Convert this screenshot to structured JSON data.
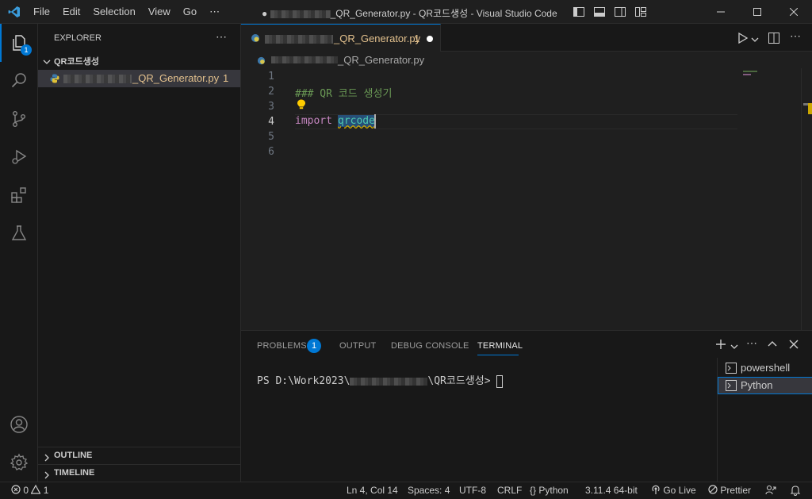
{
  "titlebar": {
    "menus": [
      "File",
      "Edit",
      "Selection",
      "View",
      "Go",
      "⋯"
    ],
    "title_suffix": "_QR_Generator.py - QR코드생성 - Visual Studio Code"
  },
  "activity": {
    "explorer_badge": "1"
  },
  "sidebar": {
    "header": "EXPLORER",
    "more": "⋯",
    "folder": "QR코드생성",
    "file_name_suffix": "_QR_Generator.py",
    "file_problems": "1",
    "outline": "OUTLINE",
    "timeline": "TIMELINE"
  },
  "editor": {
    "tab_suffix": "_QR_Generator.py",
    "tab_problems": "1",
    "breadcrumb_suffix": "_QR_Generator.py",
    "lines": [
      "1",
      "2",
      "3",
      "4",
      "5",
      "6"
    ],
    "code": {
      "comment": "### QR 코드 생성기",
      "keyword": "import",
      "module": "qrcode"
    }
  },
  "panel": {
    "tabs": [
      "PROBLEMS",
      "OUTPUT",
      "DEBUG CONSOLE",
      "TERMINAL"
    ],
    "problems_badge": "1",
    "prompt_prefix": "PS D:\\Work2023\\",
    "prompt_suffix": "\\QR코드생성>",
    "terminals": [
      "powershell",
      "Python"
    ]
  },
  "statusbar": {
    "errors": "0",
    "warnings": "1",
    "position": "Ln 4, Col 14",
    "spaces": "Spaces: 4",
    "encoding": "UTF-8",
    "eol": "CRLF",
    "language": "Python",
    "interpreter": "3.11.4 64-bit",
    "golive": "Go Live",
    "prettier": "Prettier"
  },
  "colors": {
    "accent": "#0078d4",
    "modified_file": "#e2c08d",
    "comment": "#6a9955",
    "keyword": "#c586c0",
    "module": "#4ec9b0"
  }
}
